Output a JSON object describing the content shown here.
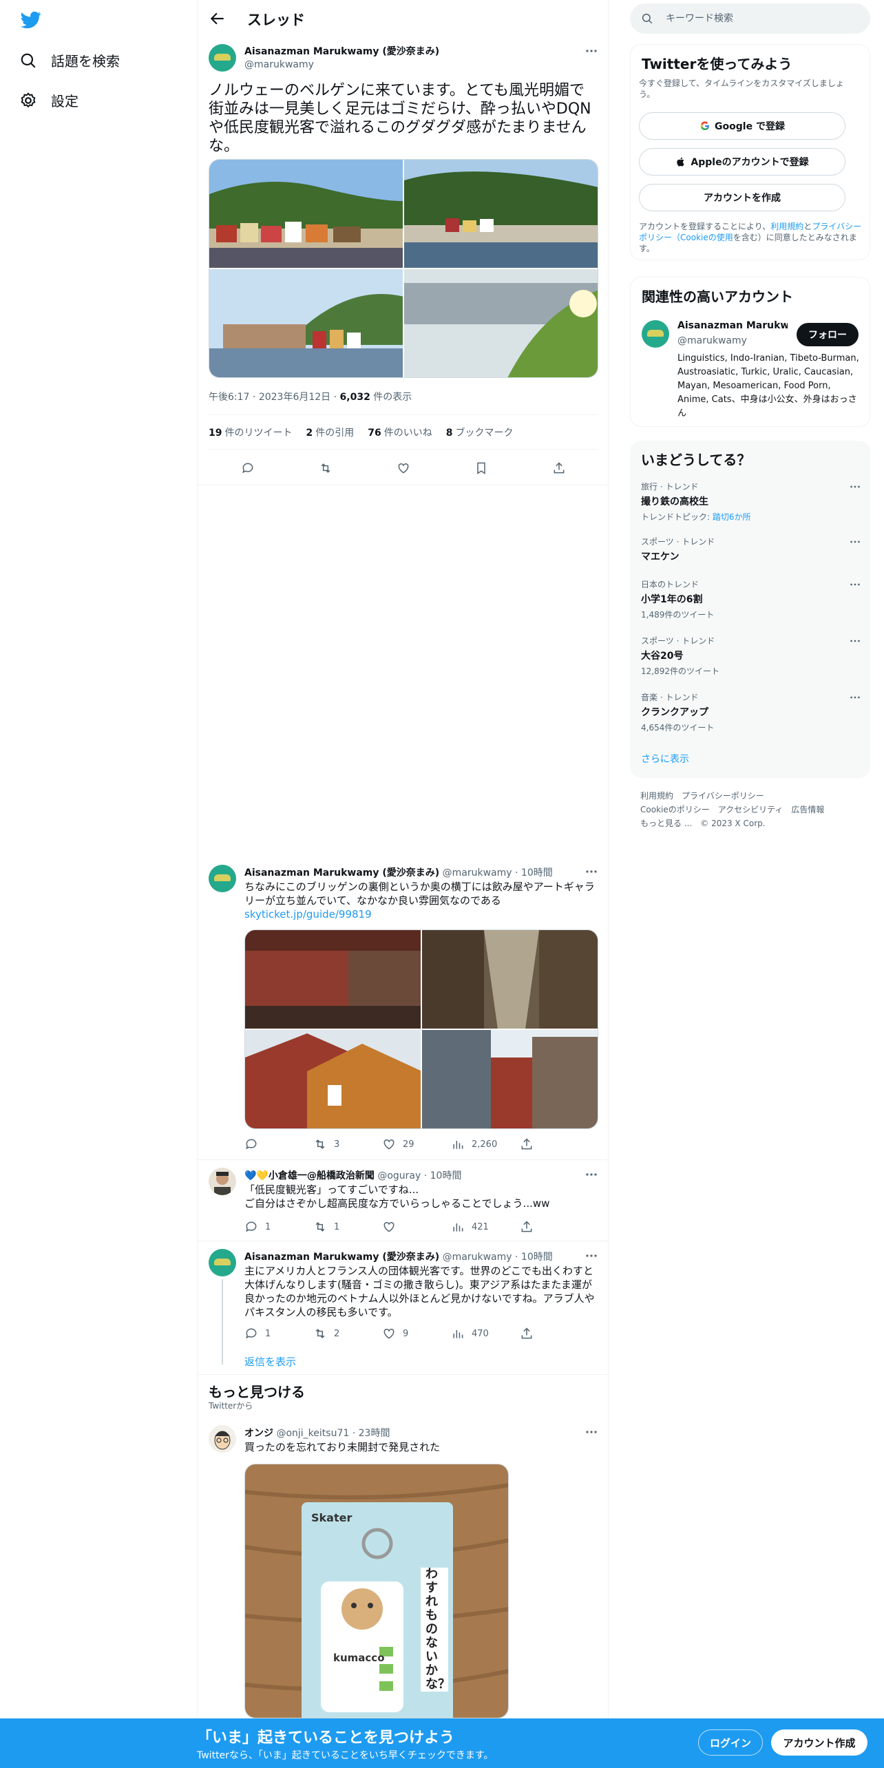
{
  "nav": {
    "logo": "twitter-bird-icon",
    "explore_label": "話題を検索",
    "settings_label": "設定"
  },
  "header": {
    "title": "スレッド"
  },
  "main_tweet": {
    "author_name": "Aisanazman Marukwamy (愛沙奈まみ)",
    "author_handle": "@marukwamy",
    "text": "ノルウェーのベルゲンに来ています。とても風光明媚で街並みは一見美しく足元はゴミだらけ、酔っ払いやDQNや低民度観光客で溢れるこのグダグダ感がたまりませんな。",
    "time": "午後6:17",
    "date": "2023年6月12日",
    "views_count": "6,032",
    "views_label": "件の表示",
    "retweets_count": "19",
    "retweets_label": "件のリツイート",
    "quotes_count": "2",
    "quotes_label": "件の引用",
    "likes_count": "76",
    "likes_label": "件のいいね",
    "bookmarks_count": "8",
    "bookmarks_label": "ブックマーク"
  },
  "replies": [
    {
      "author_name": "Aisanazman Marukwamy (愛沙奈まみ)",
      "author_handle": "@marukwamy",
      "time": "10時間",
      "text": "ちなみにこのブリッゲンの裏側というか奥の横丁には飲み屋やアートギャラリーが立ち並んでいて、なかなか良い雰囲気なのである",
      "link": "skyticket.jp/guide/99819",
      "replies": "",
      "retweets": "3",
      "likes": "29",
      "views": "2,260"
    },
    {
      "author_name": "💙💛小倉雄一@船橋政治新聞",
      "author_handle": "@oguray",
      "time": "10時間",
      "text_line1": "「低民度観光客」ってすごいですね...",
      "text_line2": "ご自分はさぞかし超高民度な方でいらっしゃることでしょう...ww",
      "replies": "1",
      "retweets": "1",
      "likes": "",
      "views": "421"
    },
    {
      "author_name": "Aisanazman Marukwamy (愛沙奈まみ)",
      "author_handle": "@marukwamy",
      "time": "10時間",
      "text": "主にアメリカ人とフランス人の団体観光客です。世界のどこでも出くわすと大体げんなりします(騒音・ゴミの撒き散らし)。東アジア系はたまたま運が良かったのか地元のベトナム人以外ほとんど見かけないですね。アラブ人やパキスタン人の移民も多いです。",
      "replies": "1",
      "retweets": "2",
      "likes": "9",
      "views": "470"
    }
  ],
  "show_replies_label": "返信を表示",
  "discover": {
    "title": "もっと見つける",
    "subtitle": "Twitterから",
    "tweet": {
      "author_name": "オンジ",
      "author_handle": "@onji_keitsu71",
      "time": "23時間",
      "text": "買ったのを忘れており未開封で発見された",
      "product_brand": "Skater",
      "product_name": "kumacco",
      "product_slogan": "わすれものないかな？"
    }
  },
  "search": {
    "placeholder": "キーワード検索"
  },
  "signup_card": {
    "title": "Twitterを使ってみよう",
    "subtitle": "今すぐ登録して、タイムラインをカスタマイズしましょう。",
    "google_label": "Google で登録",
    "apple_label": "Appleのアカウントで登録",
    "create_label": "アカウントを作成",
    "legal_prefix": "アカウントを登録することにより、",
    "legal_terms": "利用規約",
    "legal_and": "と",
    "legal_privacy": "プライバシーポリシー",
    "legal_cookie": "（Cookieの使用",
    "legal_suffix": "を含む）に同意したとみなされます。"
  },
  "related_card": {
    "title": "関連性の高いアカウント",
    "name": "Aisanazman Marukwa...",
    "handle": "@marukwamy",
    "follow_label": "フォロー",
    "bio": "Linguistics, Indo-Iranian, Tibeto-Burman, Austroasiatic, Turkic, Uralic, Caucasian, Mayan, Mesoamerican, Food Porn, Anime, Cats、中身は小公女、外身はおっさん"
  },
  "trends_card": {
    "title": "いまどうしてる？",
    "trends": [
      {
        "category": "旅行 · トレンド",
        "name": "撮り鉄の高校生",
        "extra_prefix": "トレンドトピック: ",
        "extra_link": "踏切6か所"
      },
      {
        "category": "スポーツ · トレンド",
        "name": "マエケン",
        "count": ""
      },
      {
        "category": "日本のトレンド",
        "name": "小学1年の6割",
        "count": "1,489件のツイート"
      },
      {
        "category": "スポーツ · トレンド",
        "name": "大谷20号",
        "count": "12,892件のツイート"
      },
      {
        "category": "音楽 · トレンド",
        "name": "クランクアップ",
        "count": "4,654件のツイート"
      }
    ],
    "show_more": "さらに表示"
  },
  "footer": {
    "terms": "利用規約",
    "privacy": "プライバシーポリシー",
    "cookie": "Cookieのポリシー",
    "accessibility": "アクセシビリティ",
    "ads": "広告情報",
    "more": "もっと見る ...",
    "copyright": "© 2023 X Corp."
  },
  "banner": {
    "headline": "「いま」起きていることを見つけよう",
    "subline": "Twitterなら、「いま」起きていることをいち早くチェックできます。",
    "login": "ログイン",
    "signup": "アカウント作成"
  },
  "colors": {
    "accent": "#1d9bf0",
    "text": "#0f1419",
    "secondary": "#536471",
    "border": "#eff3f4"
  }
}
